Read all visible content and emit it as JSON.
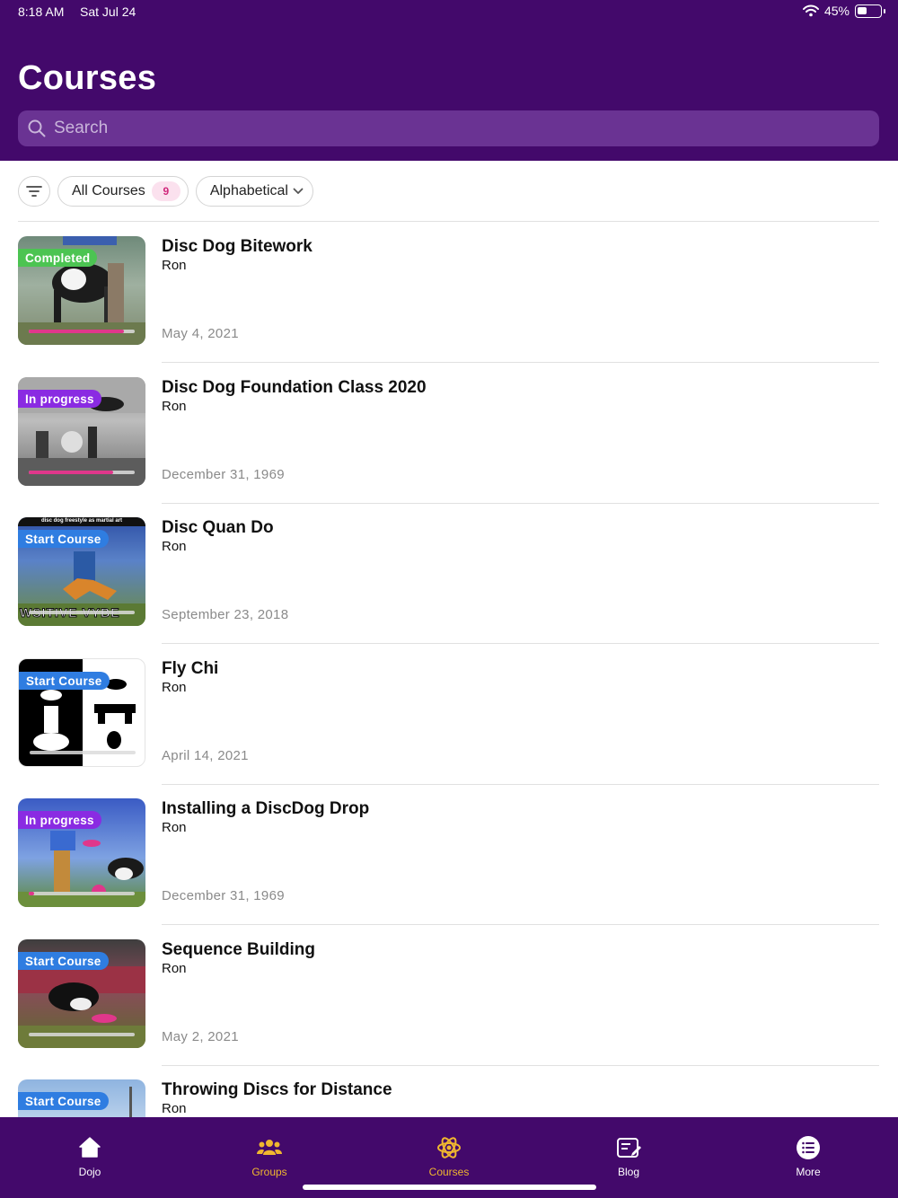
{
  "status_bar": {
    "time": "8:18 AM",
    "date": "Sat Jul 24",
    "battery": "45%",
    "battery_level": 0.45
  },
  "header": {
    "title": "Courses",
    "search_placeholder": "Search"
  },
  "filters": {
    "all_courses_label": "All Courses",
    "all_courses_count": "9",
    "sort_label": "Alphabetical"
  },
  "colors": {
    "header_bg": "#43096b",
    "accent_pink": "#e0378b",
    "badge_completed": "#4cc452",
    "badge_in_progress": "#8a2be2",
    "badge_start": "#2f7de1",
    "tab_active": "#f0b72f"
  },
  "courses": [
    {
      "title": "Disc Dog Bitework",
      "author": "Ron",
      "date": "May 4, 2021",
      "badge": "Completed",
      "badge_type": "completed",
      "progress": 0.9
    },
    {
      "title": "Disc Dog Foundation Class 2020",
      "author": "Ron",
      "date": "December 31, 1969",
      "badge": "In progress",
      "badge_type": "in_progress",
      "progress": 0.8
    },
    {
      "title": "Disc Quan Do",
      "author": "Ron",
      "date": "September 23, 2018",
      "badge": "Start Course",
      "badge_type": "start",
      "progress": 0,
      "thumb_caption": "disc dog freestyle as martial art",
      "thumb_text": "WSITIVE VYBE"
    },
    {
      "title": "Fly Chi",
      "author": "Ron",
      "date": "April 14, 2021",
      "badge": "Start Course",
      "badge_type": "start",
      "progress": 0
    },
    {
      "title": "Installing a DiscDog Drop",
      "author": "Ron",
      "date": "December 31, 1969",
      "badge": "In progress",
      "badge_type": "in_progress",
      "progress": 0.05
    },
    {
      "title": "Sequence Building",
      "author": "Ron",
      "date": "May 2, 2021",
      "badge": "Start Course",
      "badge_type": "start",
      "progress": 0
    },
    {
      "title": "Throwing Discs for Distance",
      "author": "Ron",
      "date": "",
      "badge": "Start Course",
      "badge_type": "start",
      "progress": 0
    }
  ],
  "tabs": [
    {
      "label": "Dojo",
      "icon": "home-icon"
    },
    {
      "label": "Groups",
      "icon": "groups-icon"
    },
    {
      "label": "Courses",
      "icon": "courses-icon",
      "active": true
    },
    {
      "label": "Blog",
      "icon": "blog-icon"
    },
    {
      "label": "More",
      "icon": "more-icon"
    }
  ]
}
